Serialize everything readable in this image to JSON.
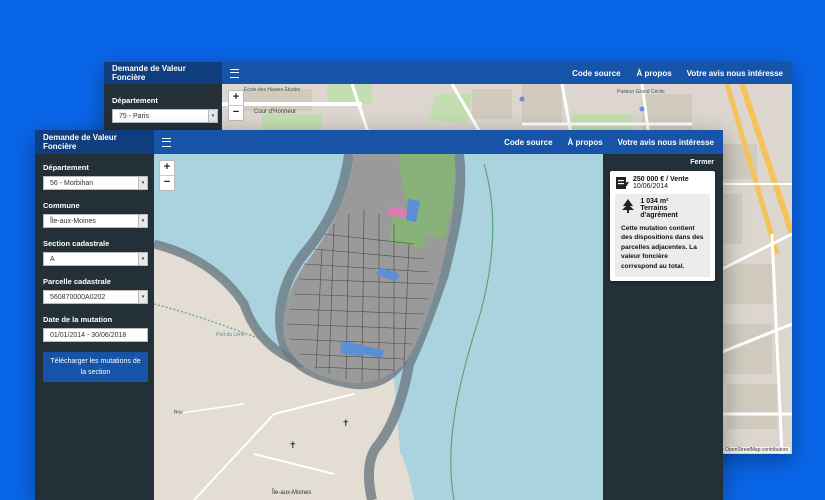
{
  "app_title": "Demande de Valeur Foncière",
  "nav": {
    "code_source": "Code source",
    "a_propos": "À propos",
    "avis": "Votre avis nous intéresse"
  },
  "back": {
    "departement_label": "Département",
    "departement_value": "75 - Paris",
    "map_labels": {
      "cour": "Cour d'Honneur",
      "ecole": "École des Hautes Études",
      "pasteur": "Pasteur Grand Cécile"
    }
  },
  "front": {
    "form": {
      "departement_label": "Département",
      "departement_value": "56 - Morbihan",
      "commune_label": "Commune",
      "commune_value": "Île-aux-Moines",
      "section_label": "Section cadastrale",
      "section_value": "A",
      "parcelle_label": "Parcelle cadastrale",
      "parcelle_value": "560870000A0202",
      "date_label": "Date de la mutation",
      "date_value": "01/01/2014 - 30/06/2018",
      "download_label": "Télécharger les mutations de la section"
    },
    "fermer": "Fermer",
    "popup": {
      "price": "250 000 € / Vente",
      "date": "10/06/2014",
      "area": "1 034 m²",
      "terrain": "Terrains d'agrément",
      "description": "Cette mutation contient des dispositions dans des parcelles adjacentes. La valeur foncière correspond au total."
    },
    "map_labels": {
      "port": "Port du Lério",
      "moines": "Île-aux-Moines",
      "brie": "Brie"
    }
  },
  "zoom": {
    "in": "+",
    "out": "−"
  },
  "attribution": "© OpenStreetMap contributors",
  "colors": {
    "navbar": "#1753a6",
    "brand": "#0f3d7d",
    "sidebar": "#243038",
    "sea": "#aad3df",
    "parcel": "#8c8c8c"
  }
}
